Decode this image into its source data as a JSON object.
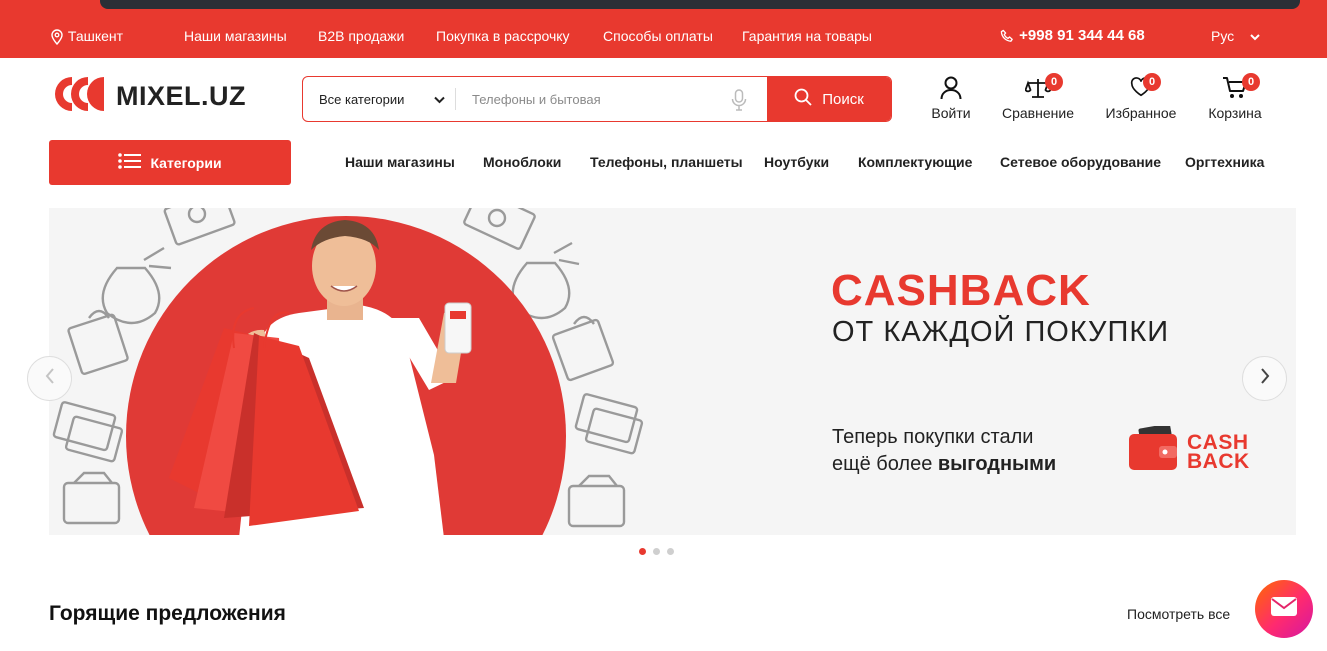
{
  "topbar": {
    "city": "Ташкент",
    "links": [
      "Наши магазины",
      "B2B продажи",
      "Покупка в рассрочку",
      "Способы оплаты",
      "Гарантия на товары"
    ],
    "phone": "+998 91 344 44 68",
    "language": "Рус"
  },
  "header": {
    "logo_text": "MIXEL.UZ",
    "search": {
      "category": "Все категории",
      "placeholder": "Телефоны и бытовая",
      "button": "Поиск"
    },
    "actions": {
      "login": "Войти",
      "compare": "Сравнение",
      "compare_count": "0",
      "favorites": "Избранное",
      "favorites_count": "0",
      "cart": "Корзина",
      "cart_count": "0"
    }
  },
  "categories_button": "Категории",
  "nav": [
    "Наши магазины",
    "Моноблоки",
    "Телефоны, планшеты",
    "Ноутбуки",
    "Комплектующие",
    "Сетевое оборудование",
    "Оргтехника"
  ],
  "banner": {
    "title": "CASHBACK",
    "subtitle": "ОТ КАЖДОЙ ПОКУПКИ",
    "line1": "Теперь покупки стали",
    "line2_prefix": "ещё более ",
    "line2_bold": "выгодными",
    "logo_line1": "CASH",
    "logo_line2": "BACK",
    "slides": 3,
    "active_slide": 1
  },
  "section": {
    "title": "Горящие предложения",
    "see_all": "Посмотреть все"
  },
  "colors": {
    "accent": "#e8392f",
    "text": "#222222"
  }
}
